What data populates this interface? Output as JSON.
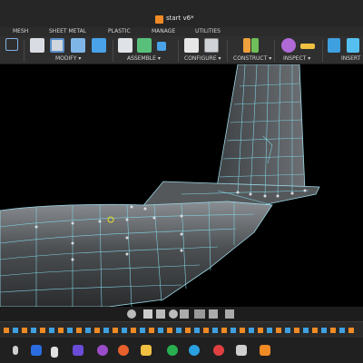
{
  "title_bar": {
    "document_title": "start v6*",
    "app_icon": "fusion-app-icon"
  },
  "tabs": [
    {
      "label": "MESH"
    },
    {
      "label": "SHEET METAL"
    },
    {
      "label": "PLASTIC"
    },
    {
      "label": "MANAGE"
    },
    {
      "label": "UTILITIES"
    }
  ],
  "toolbar_groups": [
    {
      "label": "MODIFY ▾"
    },
    {
      "label": "ASSEMBLE ▾"
    },
    {
      "label": "CONFIGURE ▾"
    },
    {
      "label": "CONSTRUCT ▾"
    },
    {
      "label": "INSPECT ▾"
    },
    {
      "label": "INSERT"
    }
  ],
  "colors": {
    "accent": "#f08a24",
    "mesh_lines": "#7fd0e0",
    "model": "#5a5d60"
  }
}
